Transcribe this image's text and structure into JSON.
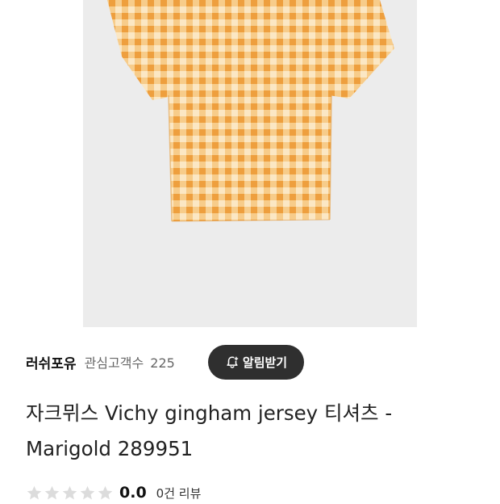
{
  "product": {
    "image_alt": "gingham t-shirt",
    "pattern_colors": {
      "base": "#fbe7c4",
      "stripe": "#f3b55a",
      "cross": "#ee9f3e",
      "bg": "#ececec"
    }
  },
  "seller": {
    "name": "러쉬포유",
    "followers_label": "관심고객수",
    "followers_count": "225"
  },
  "alarm_button": {
    "label": "알림받기",
    "icon": "bell-plus-icon"
  },
  "title": "자크뮈스 Vichy gingham jersey 티셔츠 - Marigold 289951",
  "rating": {
    "stars_filled": 0,
    "stars_total": 5,
    "score": "0.0",
    "reviews": "0건 리뷰"
  }
}
